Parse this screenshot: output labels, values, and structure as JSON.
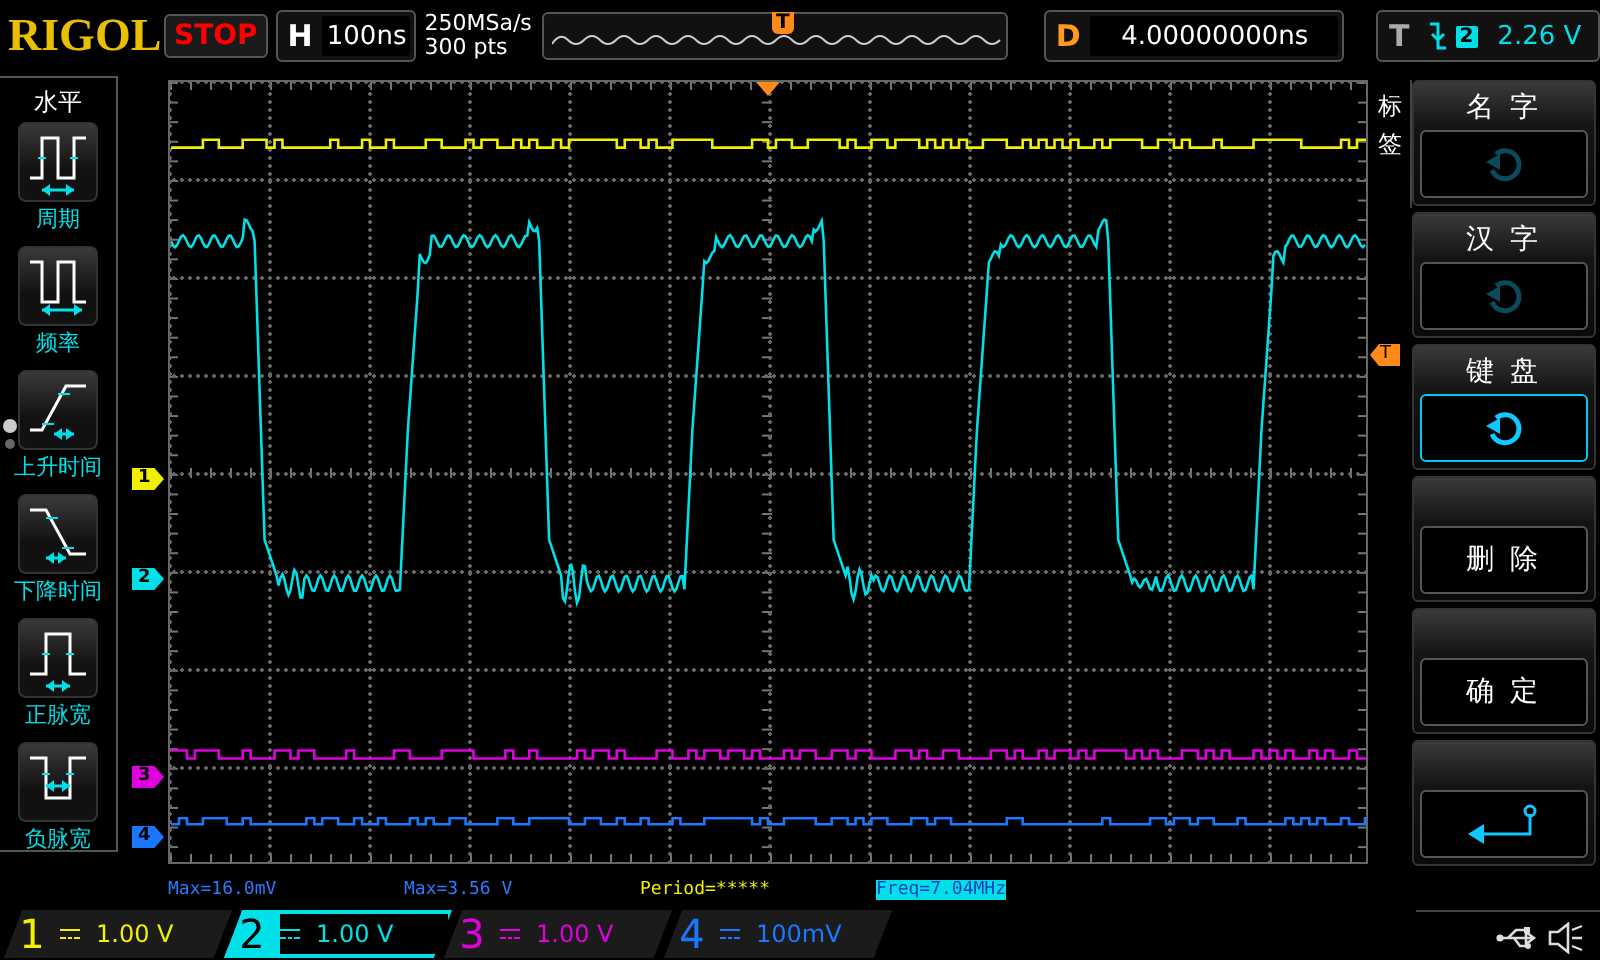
{
  "header": {
    "logo": "RIGOL",
    "run_state": "STOP",
    "timebase": {
      "label": "H",
      "value": "100ns"
    },
    "sample_rate": "250MSa/s",
    "memory_depth": "300 pts",
    "memory_trigger_mark": "T",
    "delay": {
      "label": "D",
      "value": "4.00000000ns"
    },
    "trigger": {
      "label": "T",
      "source": "2",
      "level": "2.26 V"
    }
  },
  "measure_menu": {
    "title": "水平",
    "items": [
      {
        "label": "周期",
        "kind": "period"
      },
      {
        "label": "频率",
        "kind": "frequency"
      },
      {
        "label": "上升时间",
        "kind": "rise"
      },
      {
        "label": "下降时间",
        "kind": "fall"
      },
      {
        "label": "正脉宽",
        "kind": "positive-width"
      },
      {
        "label": "负脉宽",
        "kind": "negative-width"
      }
    ]
  },
  "trigger_level_marker": "T",
  "channels": [
    {
      "number": "1",
      "marker": "1",
      "color": "#f0f000",
      "scale": "1.00 V",
      "selected": false
    },
    {
      "number": "2",
      "marker": "2",
      "color": "#00e0e8",
      "scale": "1.00 V",
      "selected": true
    },
    {
      "number": "3",
      "marker": "3",
      "color": "#e000e0",
      "scale": "1.00 V",
      "selected": false
    },
    {
      "number": "4",
      "marker": "4",
      "color": "#1a78ff",
      "scale": "100mV",
      "selected": false
    }
  ],
  "measurements": [
    {
      "text": "Max=16.0mV",
      "color": "#2a7bff",
      "selected": false
    },
    {
      "text": "Max=3.56 V",
      "color": "#2a7bff",
      "selected": false
    },
    {
      "text": "Period=*****",
      "color": "#f0f000",
      "selected": false
    },
    {
      "text": "Freq=7.04MHz",
      "color": "#00e0e8",
      "selected": true
    }
  ],
  "label_menu": {
    "tab": "标签",
    "keys": [
      {
        "kind": "rotate",
        "label": "名 字",
        "active": false
      },
      {
        "kind": "rotate",
        "label": "汉 字",
        "active": false
      },
      {
        "kind": "rotate",
        "label": "键 盘",
        "active": true
      },
      {
        "kind": "text",
        "label": "删 除"
      },
      {
        "kind": "text",
        "label": "确 定"
      },
      {
        "kind": "enter"
      }
    ]
  }
}
